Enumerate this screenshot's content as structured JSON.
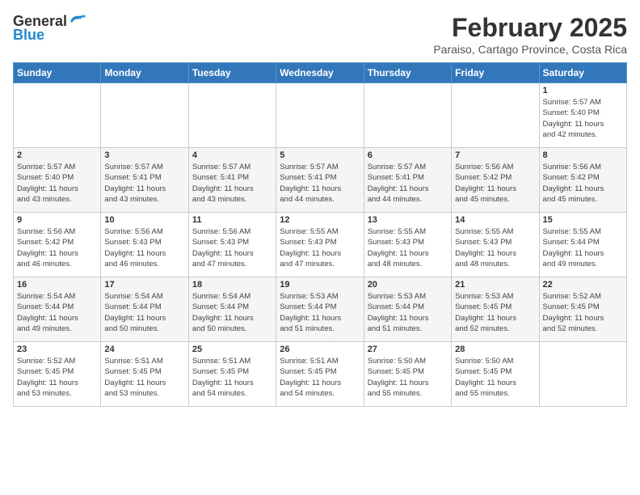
{
  "header": {
    "logo_general": "General",
    "logo_blue": "Blue",
    "month": "February 2025",
    "location": "Paraiso, Cartago Province, Costa Rica"
  },
  "weekdays": [
    "Sunday",
    "Monday",
    "Tuesday",
    "Wednesday",
    "Thursday",
    "Friday",
    "Saturday"
  ],
  "weeks": [
    [
      {
        "day": "",
        "info": ""
      },
      {
        "day": "",
        "info": ""
      },
      {
        "day": "",
        "info": ""
      },
      {
        "day": "",
        "info": ""
      },
      {
        "day": "",
        "info": ""
      },
      {
        "day": "",
        "info": ""
      },
      {
        "day": "1",
        "info": "Sunrise: 5:57 AM\nSunset: 5:40 PM\nDaylight: 11 hours\nand 42 minutes."
      }
    ],
    [
      {
        "day": "2",
        "info": "Sunrise: 5:57 AM\nSunset: 5:40 PM\nDaylight: 11 hours\nand 43 minutes."
      },
      {
        "day": "3",
        "info": "Sunrise: 5:57 AM\nSunset: 5:41 PM\nDaylight: 11 hours\nand 43 minutes."
      },
      {
        "day": "4",
        "info": "Sunrise: 5:57 AM\nSunset: 5:41 PM\nDaylight: 11 hours\nand 43 minutes."
      },
      {
        "day": "5",
        "info": "Sunrise: 5:57 AM\nSunset: 5:41 PM\nDaylight: 11 hours\nand 44 minutes."
      },
      {
        "day": "6",
        "info": "Sunrise: 5:57 AM\nSunset: 5:41 PM\nDaylight: 11 hours\nand 44 minutes."
      },
      {
        "day": "7",
        "info": "Sunrise: 5:56 AM\nSunset: 5:42 PM\nDaylight: 11 hours\nand 45 minutes."
      },
      {
        "day": "8",
        "info": "Sunrise: 5:56 AM\nSunset: 5:42 PM\nDaylight: 11 hours\nand 45 minutes."
      }
    ],
    [
      {
        "day": "9",
        "info": "Sunrise: 5:56 AM\nSunset: 5:42 PM\nDaylight: 11 hours\nand 46 minutes."
      },
      {
        "day": "10",
        "info": "Sunrise: 5:56 AM\nSunset: 5:43 PM\nDaylight: 11 hours\nand 46 minutes."
      },
      {
        "day": "11",
        "info": "Sunrise: 5:56 AM\nSunset: 5:43 PM\nDaylight: 11 hours\nand 47 minutes."
      },
      {
        "day": "12",
        "info": "Sunrise: 5:55 AM\nSunset: 5:43 PM\nDaylight: 11 hours\nand 47 minutes."
      },
      {
        "day": "13",
        "info": "Sunrise: 5:55 AM\nSunset: 5:43 PM\nDaylight: 11 hours\nand 48 minutes."
      },
      {
        "day": "14",
        "info": "Sunrise: 5:55 AM\nSunset: 5:43 PM\nDaylight: 11 hours\nand 48 minutes."
      },
      {
        "day": "15",
        "info": "Sunrise: 5:55 AM\nSunset: 5:44 PM\nDaylight: 11 hours\nand 49 minutes."
      }
    ],
    [
      {
        "day": "16",
        "info": "Sunrise: 5:54 AM\nSunset: 5:44 PM\nDaylight: 11 hours\nand 49 minutes."
      },
      {
        "day": "17",
        "info": "Sunrise: 5:54 AM\nSunset: 5:44 PM\nDaylight: 11 hours\nand 50 minutes."
      },
      {
        "day": "18",
        "info": "Sunrise: 5:54 AM\nSunset: 5:44 PM\nDaylight: 11 hours\nand 50 minutes."
      },
      {
        "day": "19",
        "info": "Sunrise: 5:53 AM\nSunset: 5:44 PM\nDaylight: 11 hours\nand 51 minutes."
      },
      {
        "day": "20",
        "info": "Sunrise: 5:53 AM\nSunset: 5:44 PM\nDaylight: 11 hours\nand 51 minutes."
      },
      {
        "day": "21",
        "info": "Sunrise: 5:53 AM\nSunset: 5:45 PM\nDaylight: 11 hours\nand 52 minutes."
      },
      {
        "day": "22",
        "info": "Sunrise: 5:52 AM\nSunset: 5:45 PM\nDaylight: 11 hours\nand 52 minutes."
      }
    ],
    [
      {
        "day": "23",
        "info": "Sunrise: 5:52 AM\nSunset: 5:45 PM\nDaylight: 11 hours\nand 53 minutes."
      },
      {
        "day": "24",
        "info": "Sunrise: 5:51 AM\nSunset: 5:45 PM\nDaylight: 11 hours\nand 53 minutes."
      },
      {
        "day": "25",
        "info": "Sunrise: 5:51 AM\nSunset: 5:45 PM\nDaylight: 11 hours\nand 54 minutes."
      },
      {
        "day": "26",
        "info": "Sunrise: 5:51 AM\nSunset: 5:45 PM\nDaylight: 11 hours\nand 54 minutes."
      },
      {
        "day": "27",
        "info": "Sunrise: 5:50 AM\nSunset: 5:45 PM\nDaylight: 11 hours\nand 55 minutes."
      },
      {
        "day": "28",
        "info": "Sunrise: 5:50 AM\nSunset: 5:45 PM\nDaylight: 11 hours\nand 55 minutes."
      },
      {
        "day": "",
        "info": ""
      }
    ]
  ]
}
